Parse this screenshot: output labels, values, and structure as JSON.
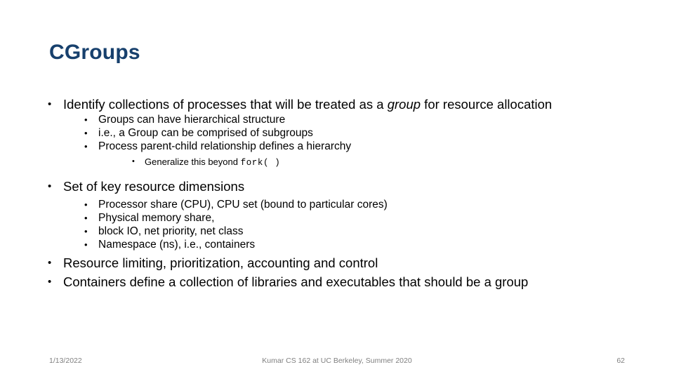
{
  "slide": {
    "title": "CGroups",
    "bullet_glyph": "•",
    "content": {
      "b1": "Identify collections of processes that will be treated as a ",
      "b1_italic": "group",
      "b1_tail": " for resource allocation",
      "b1_sub1": "Groups can have hierarchical structure",
      "b1_sub2": "i.e., a Group can be comprised of subgroups",
      "b1_sub3": "Process parent-child relationship defines a hierarchy",
      "b1_sub3_sub1_pre": "Generalize this beyond ",
      "b1_sub3_sub1_code": "fork( )",
      "b2": "Set of key resource dimensions",
      "b2_sub1": "Processor share (CPU), CPU set (bound to particular cores)",
      "b2_sub2": "Physical memory share,",
      "b2_sub3": "block IO, net priority, net class",
      "b2_sub4": "Namespace (ns), i.e., containers",
      "b3": "Resource limiting, prioritization, accounting and control",
      "b4": "Containers define a collection of libraries and executables that should be a group"
    }
  },
  "footer": {
    "date": "1/13/2022",
    "center": "Kumar CS 162 at UC Berkeley, Summer 2020",
    "page": "62"
  },
  "colors": {
    "title": "#17406D",
    "footer_text": "#7F7F7F",
    "body_text": "#000000",
    "background": "#FFFFFF"
  }
}
